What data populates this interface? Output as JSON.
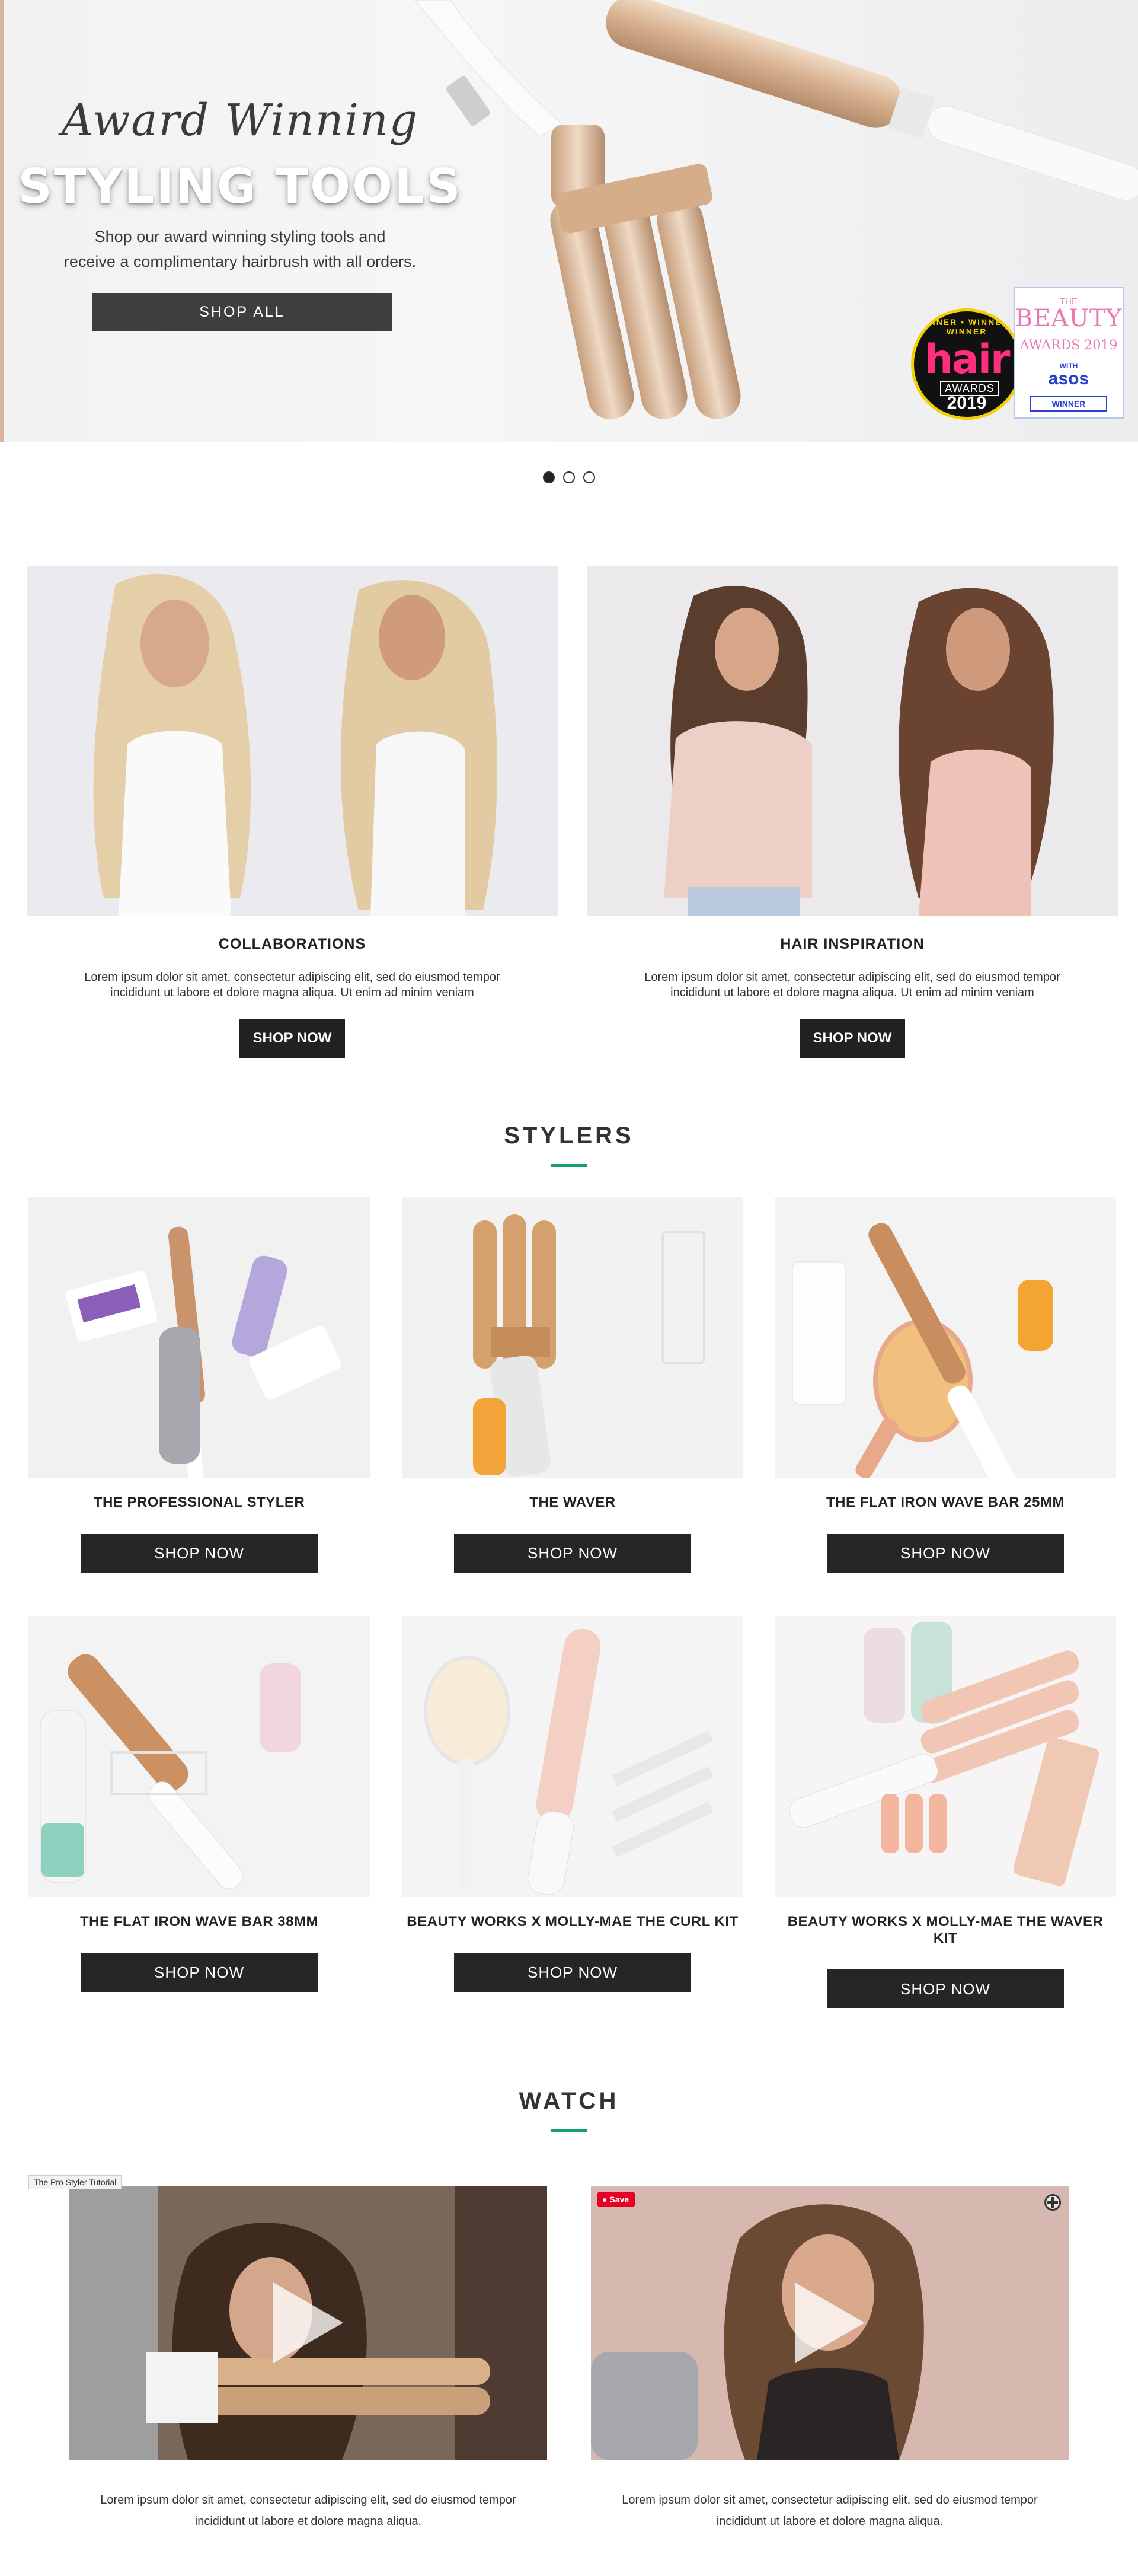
{
  "hero": {
    "script_title": "Award Winning",
    "title": "STYLING TOOLS",
    "subtitle": "Shop our award winning styling tools and\nreceive a complimentary hairbrush with all orders.",
    "cta_label": "SHOP ALL",
    "awards": {
      "hair": {
        "ring": "WINNER • WINNER • WINNER",
        "word": "hair",
        "label": "AWARDS",
        "year": "2019"
      },
      "beauty": {
        "the": "THE",
        "big": "BEAUTY",
        "line": "AWARDS 2019",
        "with": "WITH",
        "brand": "asos",
        "badge": "WINNER"
      }
    }
  },
  "carousel": {
    "slides": 3,
    "active": 0
  },
  "promos": [
    {
      "title": "COLLABORATIONS",
      "text": "Lorem ipsum dolor sit amet, consectetur adipiscing elit, sed do eiusmod tempor\nincididunt ut labore et dolore magna aliqua. Ut enim ad minim veniam",
      "cta": "SHOP NOW"
    },
    {
      "title": "HAIR INSPIRATION",
      "text": "Lorem ipsum dolor sit amet, consectetur adipiscing elit, sed do eiusmod tempor\nincididunt ut labore et dolore magna aliqua. Ut enim ad minim veniam",
      "cta": "SHOP NOW"
    }
  ],
  "stylers": {
    "heading": "STYLERS",
    "products": [
      {
        "title": "THE PROFESSIONAL STYLER",
        "cta": "SHOP NOW"
      },
      {
        "title": "THE WAVER",
        "cta": "SHOP NOW"
      },
      {
        "title": "THE FLAT IRON WAVE BAR 25MM",
        "cta": "SHOP NOW"
      },
      {
        "title": "THE FLAT IRON WAVE BAR 38MM",
        "cta": "SHOP NOW"
      },
      {
        "title": "BEAUTY WORKS X MOLLY-MAE THE CURL KIT",
        "cta": "SHOP NOW"
      },
      {
        "title": "BEAUTY WORKS X MOLLY-MAE THE WAVER KIT",
        "cta": "SHOP NOW"
      }
    ]
  },
  "watch": {
    "heading": "WATCH",
    "video_tag": "The Pro Styler Tutorial",
    "save_label": "Save",
    "videos": [
      {
        "text": "Lorem ipsum dolor sit amet, consectetur adipiscing elit, sed do eiusmod tempor\nincididunt ut labore et dolore magna aliqua."
      },
      {
        "text": "Lorem ipsum dolor sit amet, consectetur adipiscing elit, sed do eiusmod tempor\nincididunt ut labore et dolore magna aliqua."
      }
    ]
  },
  "colors": {
    "accent": "#1a9d75",
    "button": "#222222",
    "pinterest": "#e60023"
  }
}
